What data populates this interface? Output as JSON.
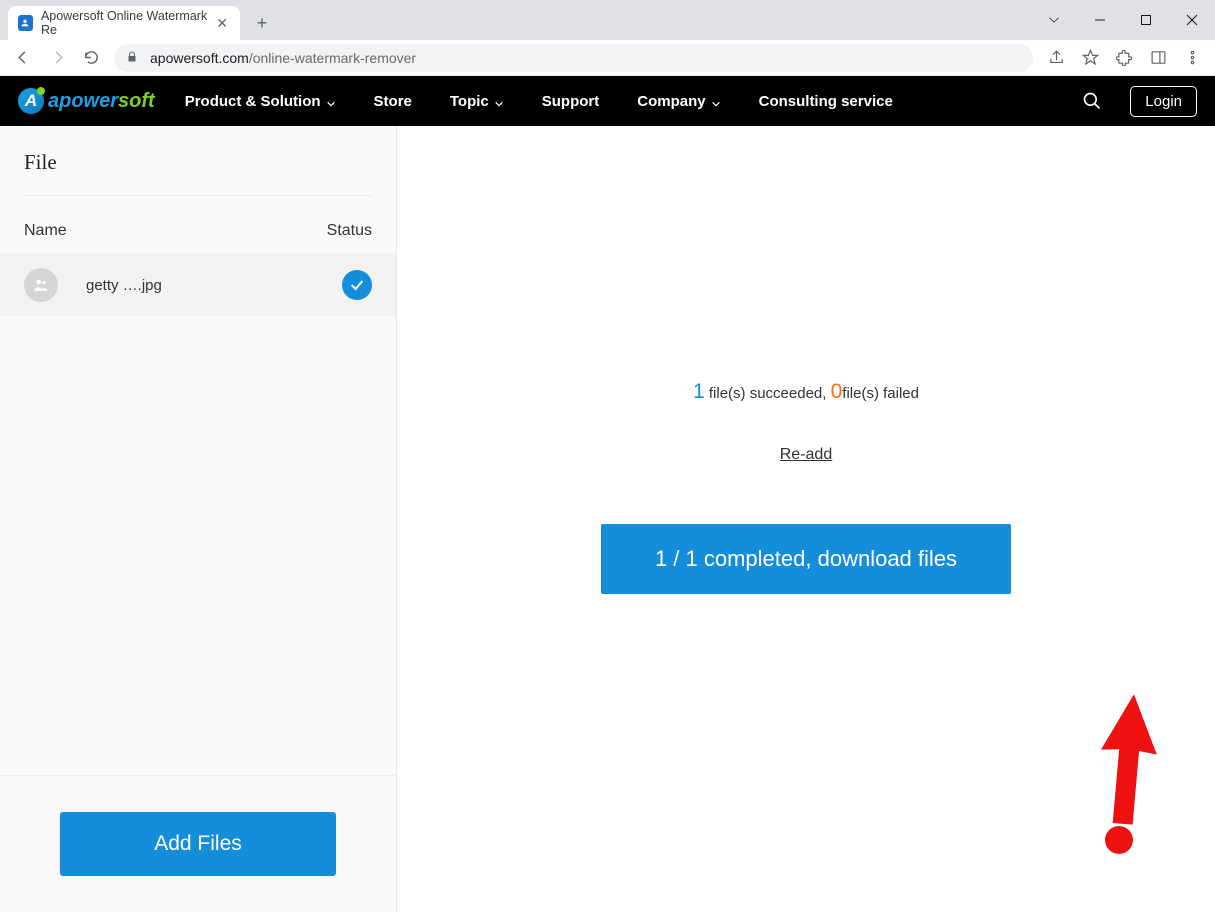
{
  "browser": {
    "tab_title": "Apowersoft Online Watermark Re",
    "url_domain": "apowersoft.com",
    "url_path": "/online-watermark-remover"
  },
  "site_header": {
    "brand_a": "apower",
    "brand_b": "soft",
    "nav": {
      "product": "Product & Solution",
      "store": "Store",
      "topic": "Topic",
      "support": "Support",
      "company": "Company",
      "consulting": "Consulting service"
    },
    "login": "Login"
  },
  "sidebar": {
    "title": "File",
    "col_name": "Name",
    "col_status": "Status",
    "files": [
      {
        "name": "getty ….jpg"
      }
    ],
    "add_files": "Add Files"
  },
  "main": {
    "succeeded_count": "1",
    "succeeded_label": " file(s) succeeded, ",
    "failed_count": "0",
    "failed_label": "file(s) failed",
    "readd": "Re-add",
    "download": "1 / 1 completed, download files"
  }
}
